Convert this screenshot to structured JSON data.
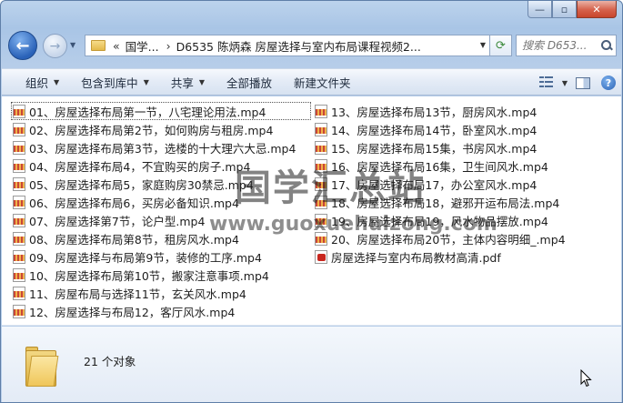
{
  "window": {
    "controls": {
      "minimize": "—",
      "maximize": "▫",
      "close": "✕"
    }
  },
  "nav": {
    "back": "←",
    "forward": "→",
    "breadcrumb": [
      "«",
      "国学...",
      "D6535 陈炳森 房屋选择与室内布局课程视频2..."
    ],
    "search_placeholder": "搜索 D653..."
  },
  "toolbar": {
    "organize": "组织",
    "include_in_library": "包含到库中",
    "share": "共享",
    "play_all": "全部播放",
    "new_folder": "新建文件夹"
  },
  "files_col1": [
    {
      "name": "01、房屋选择布局第一节，八宅理论用法.mp4",
      "type": "mp4"
    },
    {
      "name": "02、房屋选择布局第2节，如何购房与租房.mp4",
      "type": "mp4"
    },
    {
      "name": "03、房屋选择布局第3节，选楼的十大理六大忌.mp4",
      "type": "mp4"
    },
    {
      "name": "04、房屋选择布局4，不宜购买的房子.mp4",
      "type": "mp4"
    },
    {
      "name": "05、房屋选择布局5，家庭购房30禁忌.mp4",
      "type": "mp4"
    },
    {
      "name": "06、房屋选择布局6，买房必备知识.mp4",
      "type": "mp4"
    },
    {
      "name": "07、房屋选择第7节，论户型.mp4",
      "type": "mp4"
    },
    {
      "name": "08、房屋选择布局第8节，租房风水.mp4",
      "type": "mp4"
    },
    {
      "name": "09、房屋选择与布局第9节，装修的工序.mp4",
      "type": "mp4"
    },
    {
      "name": "10、房屋选择布局第10节，搬家注意事项.mp4",
      "type": "mp4"
    },
    {
      "name": "11、房屋布局与选择11节，玄关风水.mp4",
      "type": "mp4"
    },
    {
      "name": "12、房屋选择与布局12，客厅风水.mp4",
      "type": "mp4"
    }
  ],
  "files_col2": [
    {
      "name": "13、房屋选择布局13节，厨房风水.mp4",
      "type": "mp4"
    },
    {
      "name": "14、房屋选择布局14节，卧室风水.mp4",
      "type": "mp4"
    },
    {
      "name": "15、房屋选择布局15集，书房风水.mp4",
      "type": "mp4"
    },
    {
      "name": "16、房屋选择布局16集，卫生间风水.mp4",
      "type": "mp4"
    },
    {
      "name": "17、房屋选择布局17，办公室风水.mp4",
      "type": "mp4"
    },
    {
      "name": "18、房屋选择布局18，避邪开运布局法.mp4",
      "type": "mp4"
    },
    {
      "name": "19、房屋选择布局19，风水物品摆放.mp4",
      "type": "mp4"
    },
    {
      "name": "20、房屋选择布局20节，主体内容明细_.mp4",
      "type": "mp4"
    },
    {
      "name": "房屋选择与室内布局教材高清.pdf",
      "type": "pdf"
    }
  ],
  "watermark": {
    "text": "国学汇总站",
    "url": "www.guoxuehuizong.com"
  },
  "details": {
    "count": "21 个对象"
  }
}
